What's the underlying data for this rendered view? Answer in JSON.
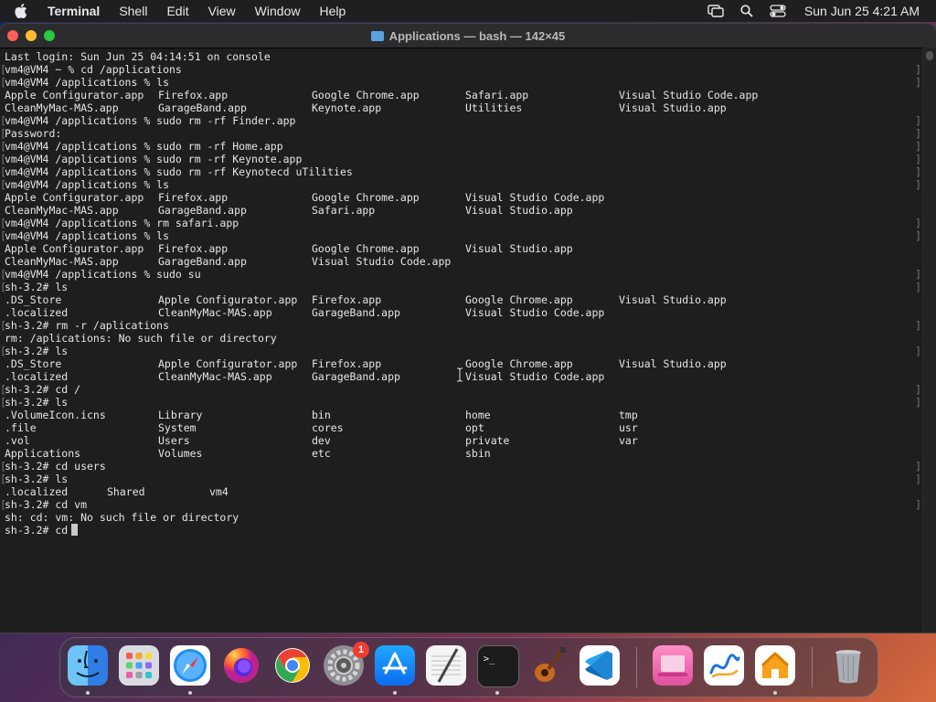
{
  "menubar": {
    "app_name": "Terminal",
    "items": [
      "Shell",
      "Edit",
      "View",
      "Window",
      "Help"
    ],
    "clock": "Sun Jun 25  4:21 AM"
  },
  "window": {
    "title": "Applications — bash — 142×45"
  },
  "terminal": {
    "lines": [
      {
        "cols": [
          "Last login: Sun Jun 25 04:14:51 on console"
        ],
        "mark": false
      },
      {
        "cols": [
          "vm4@VM4 ~ % cd /applications"
        ],
        "mark": true
      },
      {
        "cols": [
          "vm4@VM4 /applications % ls"
        ],
        "mark": true
      },
      {
        "cols": [
          "Apple Configurator.app",
          "Firefox.app",
          "Google Chrome.app",
          "Safari.app",
          "Visual Studio Code.app"
        ],
        "mark": false
      },
      {
        "cols": [
          "CleanMyMac-MAS.app",
          "GarageBand.app",
          "Keynote.app",
          "Utilities",
          "Visual Studio.app"
        ],
        "mark": false
      },
      {
        "cols": [
          "vm4@VM4 /applications % sudo rm -rf Finder.app"
        ],
        "mark": true
      },
      {
        "cols": [
          "Password:"
        ],
        "mark": true
      },
      {
        "cols": [
          "vm4@VM4 /applications % sudo rm -rf Home.app"
        ],
        "mark": true
      },
      {
        "cols": [
          "vm4@VM4 /applications % sudo rm -rf Keynote.app"
        ],
        "mark": true
      },
      {
        "cols": [
          "vm4@VM4 /applications % sudo rm -rf Keynotecd uTilities"
        ],
        "mark": true
      },
      {
        "cols": [
          "vm4@VM4 /applications % ls"
        ],
        "mark": true
      },
      {
        "cols": [
          "Apple Configurator.app",
          "Firefox.app",
          "Google Chrome.app",
          "Visual Studio Code.app"
        ],
        "mark": false
      },
      {
        "cols": [
          "CleanMyMac-MAS.app",
          "GarageBand.app",
          "Safari.app",
          "Visual Studio.app"
        ],
        "mark": false
      },
      {
        "cols": [
          "vm4@VM4 /applications % rm safari.app"
        ],
        "mark": true
      },
      {
        "cols": [
          "vm4@VM4 /applications % ls"
        ],
        "mark": true
      },
      {
        "cols": [
          "Apple Configurator.app",
          "Firefox.app",
          "Google Chrome.app",
          "Visual Studio.app"
        ],
        "mark": false
      },
      {
        "cols": [
          "CleanMyMac-MAS.app",
          "GarageBand.app",
          "Visual Studio Code.app"
        ],
        "mark": false
      },
      {
        "cols": [
          "vm4@VM4 /applications % sudo su"
        ],
        "mark": true
      },
      {
        "cols": [
          "sh-3.2# ls"
        ],
        "mark": true
      },
      {
        "cols": [
          ".DS_Store",
          "Apple Configurator.app",
          "Firefox.app",
          "Google Chrome.app",
          "Visual Studio.app"
        ],
        "mark": false
      },
      {
        "cols": [
          ".localized",
          "CleanMyMac-MAS.app",
          "GarageBand.app",
          "Visual Studio Code.app"
        ],
        "mark": false
      },
      {
        "cols": [
          "sh-3.2# rm -r /aplications"
        ],
        "mark": true
      },
      {
        "cols": [
          "rm: /aplications: No such file or directory"
        ],
        "mark": false
      },
      {
        "cols": [
          "sh-3.2# ls"
        ],
        "mark": true
      },
      {
        "cols": [
          ".DS_Store",
          "Apple Configurator.app",
          "Firefox.app",
          "Google Chrome.app",
          "Visual Studio.app"
        ],
        "mark": false
      },
      {
        "cols": [
          ".localized",
          "CleanMyMac-MAS.app",
          "GarageBand.app",
          "Visual Studio Code.app"
        ],
        "mark": false
      },
      {
        "cols": [
          "sh-3.2# cd /"
        ],
        "mark": true
      },
      {
        "cols": [
          "sh-3.2# ls"
        ],
        "mark": true
      },
      {
        "cols": [
          ".VolumeIcon.icns",
          "Library",
          "bin",
          "home",
          "tmp"
        ],
        "mark": false
      },
      {
        "cols": [
          ".file",
          "System",
          "cores",
          "opt",
          "usr"
        ],
        "mark": false
      },
      {
        "cols": [
          ".vol",
          "Users",
          "dev",
          "private",
          "var"
        ],
        "mark": false
      },
      {
        "cols": [
          "Applications",
          "Volumes",
          "etc",
          "sbin"
        ],
        "mark": false
      },
      {
        "cols": [
          "sh-3.2# cd users"
        ],
        "mark": true
      },
      {
        "cols": [
          "sh-3.2# ls"
        ],
        "mark": true
      },
      {
        "cols": [
          ".localized",
          "Shared",
          "vm4"
        ],
        "mark": false,
        "narrow": true
      },
      {
        "cols": [
          "sh-3.2# cd vm"
        ],
        "mark": true
      },
      {
        "cols": [
          "sh: cd: vm: No such file or directory"
        ],
        "mark": false
      },
      {
        "cols": [
          "sh-3.2# cd"
        ],
        "mark": false,
        "cursor": true
      }
    ]
  },
  "dock": {
    "apps": [
      "Finder",
      "Launchpad",
      "Safari",
      "Firefox",
      "Google Chrome",
      "System Settings",
      "App Store",
      "TextEdit",
      "Terminal",
      "GarageBand",
      "Visual Studio Code",
      "CleanMyMac",
      "Freeform",
      "Home",
      "Trash"
    ],
    "settings_badge": "1"
  },
  "colors": {
    "close": "#fe5f57",
    "minimize": "#febc2e",
    "zoom": "#28c840",
    "terminal_bg": "#1e1e1e",
    "text": "#e6e6e6"
  }
}
